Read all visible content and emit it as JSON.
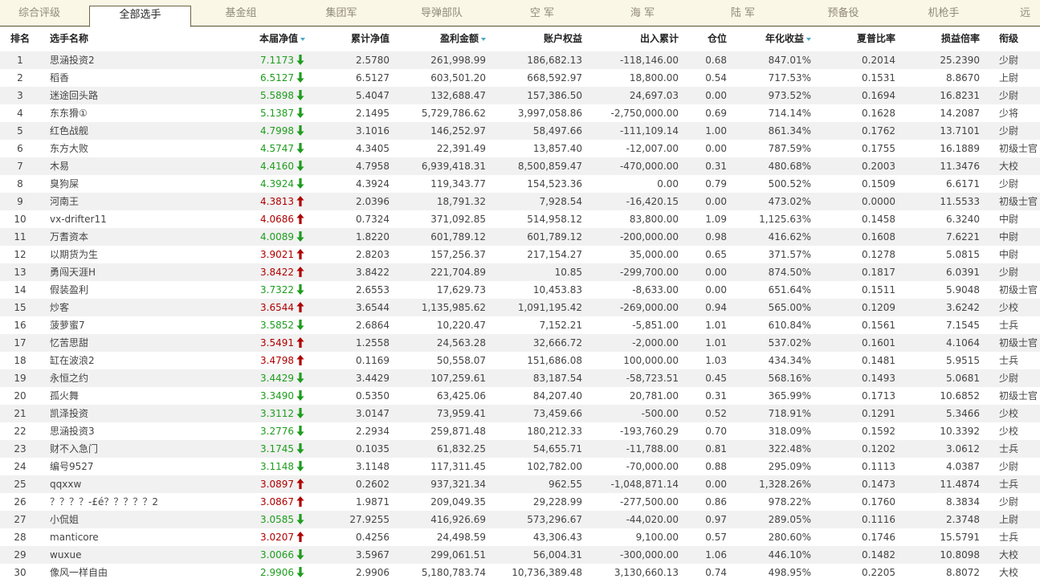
{
  "tabs": [
    "综合评级",
    "全部选手",
    "基金组",
    "集团军",
    "导弹部队",
    "空 军",
    "海 军",
    "陆 军",
    "预备役",
    "机枪手",
    "远"
  ],
  "active_tab": 1,
  "headers": {
    "rank": "排名",
    "name": "选手名称",
    "nav": "本届净值",
    "cum_nav": "累计净值",
    "profit": "盈利金额",
    "equity": "账户权益",
    "flow": "出入累计",
    "position": "仓位",
    "annual": "年化收益",
    "sharpe": "夏普比率",
    "pl_ratio": "损益倍率",
    "title": "衔级"
  },
  "sorted_columns": [
    "nav",
    "profit",
    "annual"
  ],
  "colors": {
    "up": "#b00000",
    "down": "#1e9d1e",
    "sort_indicator": "#4aa8c8",
    "tab_border": "#6e6447"
  },
  "rows": [
    {
      "rank": "1",
      "name": "思涵投资2",
      "nav": "7.1173",
      "trend": "down",
      "cum_nav": "2.5780",
      "profit": "261,998.99",
      "equity": "186,682.13",
      "flow": "-118,146.00",
      "position": "0.68",
      "annual": "847.01%",
      "sharpe": "0.2014",
      "pl_ratio": "25.2390",
      "title": "少尉"
    },
    {
      "rank": "2",
      "name": "稻香",
      "nav": "6.5127",
      "trend": "down",
      "cum_nav": "6.5127",
      "profit": "603,501.20",
      "equity": "668,592.97",
      "flow": "18,800.00",
      "position": "0.54",
      "annual": "717.53%",
      "sharpe": "0.1531",
      "pl_ratio": "8.8670",
      "title": "上尉"
    },
    {
      "rank": "3",
      "name": "迷途回头路",
      "nav": "5.5898",
      "trend": "down",
      "cum_nav": "5.4047",
      "profit": "132,688.47",
      "equity": "157,386.50",
      "flow": "24,697.03",
      "position": "0.00",
      "annual": "973.52%",
      "sharpe": "0.1694",
      "pl_ratio": "16.8231",
      "title": "少尉"
    },
    {
      "rank": "4",
      "name": "东东猾①",
      "nav": "5.1387",
      "trend": "down",
      "cum_nav": "2.1495",
      "profit": "5,729,786.62",
      "equity": "3,997,058.86",
      "flow": "-2,750,000.00",
      "position": "0.69",
      "annual": "714.14%",
      "sharpe": "0.1628",
      "pl_ratio": "14.2087",
      "title": "少将"
    },
    {
      "rank": "5",
      "name": "红色战舰",
      "nav": "4.7998",
      "trend": "down",
      "cum_nav": "3.1016",
      "profit": "146,252.97",
      "equity": "58,497.66",
      "flow": "-111,109.14",
      "position": "1.00",
      "annual": "861.34%",
      "sharpe": "0.1762",
      "pl_ratio": "13.7101",
      "title": "少尉"
    },
    {
      "rank": "6",
      "name": "东方大败",
      "nav": "4.5747",
      "trend": "down",
      "cum_nav": "4.3405",
      "profit": "22,391.49",
      "equity": "13,857.40",
      "flow": "-12,007.00",
      "position": "0.00",
      "annual": "787.59%",
      "sharpe": "0.1755",
      "pl_ratio": "16.1889",
      "title": "初级士官"
    },
    {
      "rank": "7",
      "name": "木易",
      "nav": "4.4160",
      "trend": "down",
      "cum_nav": "4.7958",
      "profit": "6,939,418.31",
      "equity": "8,500,859.47",
      "flow": "-470,000.00",
      "position": "0.31",
      "annual": "480.68%",
      "sharpe": "0.2003",
      "pl_ratio": "11.3476",
      "title": "大校"
    },
    {
      "rank": "8",
      "name": "臭狗屎",
      "nav": "4.3924",
      "trend": "down",
      "cum_nav": "4.3924",
      "profit": "119,343.77",
      "equity": "154,523.36",
      "flow": "0.00",
      "position": "0.79",
      "annual": "500.52%",
      "sharpe": "0.1509",
      "pl_ratio": "6.6171",
      "title": "少尉"
    },
    {
      "rank": "9",
      "name": "河南王",
      "nav": "4.3813",
      "trend": "up",
      "cum_nav": "2.0396",
      "profit": "18,791.32",
      "equity": "7,928.54",
      "flow": "-16,420.15",
      "position": "0.00",
      "annual": "473.02%",
      "sharpe": "0.0000",
      "pl_ratio": "11.5533",
      "title": "初级士官"
    },
    {
      "rank": "10",
      "name": "vx-drifter11",
      "nav": "4.0686",
      "trend": "up",
      "cum_nav": "0.7324",
      "profit": "371,092.85",
      "equity": "514,958.12",
      "flow": "83,800.00",
      "position": "1.09",
      "annual": "1,125.63%",
      "sharpe": "0.1458",
      "pl_ratio": "6.3240",
      "title": "中尉"
    },
    {
      "rank": "11",
      "name": "万耆资本",
      "nav": "4.0089",
      "trend": "down",
      "cum_nav": "1.8220",
      "profit": "601,789.12",
      "equity": "601,789.12",
      "flow": "-200,000.00",
      "position": "0.98",
      "annual": "416.62%",
      "sharpe": "0.1608",
      "pl_ratio": "7.6221",
      "title": "中尉"
    },
    {
      "rank": "12",
      "name": "以期货为生",
      "nav": "3.9021",
      "trend": "up",
      "cum_nav": "2.8203",
      "profit": "157,256.37",
      "equity": "217,154.27",
      "flow": "35,000.00",
      "position": "0.65",
      "annual": "371.57%",
      "sharpe": "0.1278",
      "pl_ratio": "5.0815",
      "title": "中尉"
    },
    {
      "rank": "13",
      "name": "勇闯天涯H",
      "nav": "3.8422",
      "trend": "up",
      "cum_nav": "3.8422",
      "profit": "221,704.89",
      "equity": "10.85",
      "flow": "-299,700.00",
      "position": "0.00",
      "annual": "874.50%",
      "sharpe": "0.1817",
      "pl_ratio": "6.0391",
      "title": "少尉"
    },
    {
      "rank": "14",
      "name": "假装盈利",
      "nav": "3.7322",
      "trend": "down",
      "cum_nav": "2.6553",
      "profit": "17,629.73",
      "equity": "10,453.83",
      "flow": "-8,633.00",
      "position": "0.00",
      "annual": "651.64%",
      "sharpe": "0.1511",
      "pl_ratio": "5.9048",
      "title": "初级士官"
    },
    {
      "rank": "15",
      "name": "炒客",
      "nav": "3.6544",
      "trend": "up",
      "cum_nav": "3.6544",
      "profit": "1,135,985.62",
      "equity": "1,091,195.42",
      "flow": "-269,000.00",
      "position": "0.94",
      "annual": "565.00%",
      "sharpe": "0.1209",
      "pl_ratio": "3.6242",
      "title": "少校"
    },
    {
      "rank": "16",
      "name": "菠萝蜜7",
      "nav": "3.5852",
      "trend": "down",
      "cum_nav": "2.6864",
      "profit": "10,220.47",
      "equity": "7,152.21",
      "flow": "-5,851.00",
      "position": "1.01",
      "annual": "610.84%",
      "sharpe": "0.1561",
      "pl_ratio": "7.1545",
      "title": "士兵"
    },
    {
      "rank": "17",
      "name": "忆苦思甜",
      "nav": "3.5491",
      "trend": "up",
      "cum_nav": "1.2558",
      "profit": "24,563.28",
      "equity": "32,666.72",
      "flow": "-2,000.00",
      "position": "1.01",
      "annual": "537.02%",
      "sharpe": "0.1601",
      "pl_ratio": "4.1064",
      "title": "初级士官"
    },
    {
      "rank": "18",
      "name": "缸在波浪2",
      "nav": "3.4798",
      "trend": "up",
      "cum_nav": "0.1169",
      "profit": "50,558.07",
      "equity": "151,686.08",
      "flow": "100,000.00",
      "position": "1.03",
      "annual": "434.34%",
      "sharpe": "0.1481",
      "pl_ratio": "5.9515",
      "title": "士兵"
    },
    {
      "rank": "19",
      "name": "永恒之约",
      "nav": "3.4429",
      "trend": "down",
      "cum_nav": "3.4429",
      "profit": "107,259.61",
      "equity": "83,187.54",
      "flow": "-58,723.51",
      "position": "0.45",
      "annual": "568.16%",
      "sharpe": "0.1493",
      "pl_ratio": "5.0681",
      "title": "少尉"
    },
    {
      "rank": "20",
      "name": "孤火舞",
      "nav": "3.3490",
      "trend": "down",
      "cum_nav": "0.5350",
      "profit": "63,425.06",
      "equity": "84,207.40",
      "flow": "20,781.00",
      "position": "0.31",
      "annual": "365.99%",
      "sharpe": "0.1713",
      "pl_ratio": "10.6852",
      "title": "初级士官"
    },
    {
      "rank": "21",
      "name": "凯泽投资",
      "nav": "3.3112",
      "trend": "down",
      "cum_nav": "3.0147",
      "profit": "73,959.41",
      "equity": "73,459.66",
      "flow": "-500.00",
      "position": "0.52",
      "annual": "718.91%",
      "sharpe": "0.1291",
      "pl_ratio": "5.3466",
      "title": "少校"
    },
    {
      "rank": "22",
      "name": "思涵投资3",
      "nav": "3.2776",
      "trend": "down",
      "cum_nav": "2.2934",
      "profit": "259,871.48",
      "equity": "180,212.33",
      "flow": "-193,760.29",
      "position": "0.70",
      "annual": "318.09%",
      "sharpe": "0.1592",
      "pl_ratio": "10.3392",
      "title": "少校"
    },
    {
      "rank": "23",
      "name": "财不入急门",
      "nav": "3.1745",
      "trend": "down",
      "cum_nav": "0.1035",
      "profit": "61,832.25",
      "equity": "54,655.71",
      "flow": "-11,788.00",
      "position": "0.81",
      "annual": "322.48%",
      "sharpe": "0.1202",
      "pl_ratio": "3.0612",
      "title": "士兵"
    },
    {
      "rank": "24",
      "name": "编号9527",
      "nav": "3.1148",
      "trend": "down",
      "cum_nav": "3.1148",
      "profit": "117,311.45",
      "equity": "102,782.00",
      "flow": "-70,000.00",
      "position": "0.88",
      "annual": "295.09%",
      "sharpe": "0.1113",
      "pl_ratio": "4.0387",
      "title": "少尉"
    },
    {
      "rank": "25",
      "name": "qqxxw",
      "nav": "3.0897",
      "trend": "up",
      "cum_nav": "0.2602",
      "profit": "937,321.34",
      "equity": "962.55",
      "flow": "-1,048,871.14",
      "position": "0.00",
      "annual": "1,328.26%",
      "sharpe": "0.1473",
      "pl_ratio": "11.4874",
      "title": "士兵"
    },
    {
      "rank": "26",
      "name": "？？？？-£é？？？？？2",
      "nav": "3.0867",
      "trend": "up",
      "cum_nav": "1.9871",
      "profit": "209,049.35",
      "equity": "29,228.99",
      "flow": "-277,500.00",
      "position": "0.86",
      "annual": "978.22%",
      "sharpe": "0.1760",
      "pl_ratio": "8.3834",
      "title": "少尉"
    },
    {
      "rank": "27",
      "name": "小侃姐",
      "nav": "3.0585",
      "trend": "down",
      "cum_nav": "27.9255",
      "profit": "416,926.69",
      "equity": "573,296.67",
      "flow": "-44,020.00",
      "position": "0.97",
      "annual": "289.05%",
      "sharpe": "0.1116",
      "pl_ratio": "2.3748",
      "title": "上尉"
    },
    {
      "rank": "28",
      "name": "manticore",
      "nav": "3.0207",
      "trend": "up",
      "cum_nav": "0.4256",
      "profit": "24,498.59",
      "equity": "43,306.43",
      "flow": "9,100.00",
      "position": "0.57",
      "annual": "280.60%",
      "sharpe": "0.1746",
      "pl_ratio": "15.5791",
      "title": "士兵"
    },
    {
      "rank": "29",
      "name": "wuxue",
      "nav": "3.0066",
      "trend": "down",
      "cum_nav": "3.5967",
      "profit": "299,061.51",
      "equity": "56,004.31",
      "flow": "-300,000.00",
      "position": "1.06",
      "annual": "446.10%",
      "sharpe": "0.1482",
      "pl_ratio": "10.8098",
      "title": "大校"
    },
    {
      "rank": "30",
      "name": "像风一样自由",
      "nav": "2.9906",
      "trend": "down",
      "cum_nav": "2.9906",
      "profit": "5,180,783.74",
      "equity": "10,736,389.48",
      "flow": "3,130,660.13",
      "position": "0.74",
      "annual": "498.95%",
      "sharpe": "0.2205",
      "pl_ratio": "8.8072",
      "title": "大校"
    }
  ]
}
